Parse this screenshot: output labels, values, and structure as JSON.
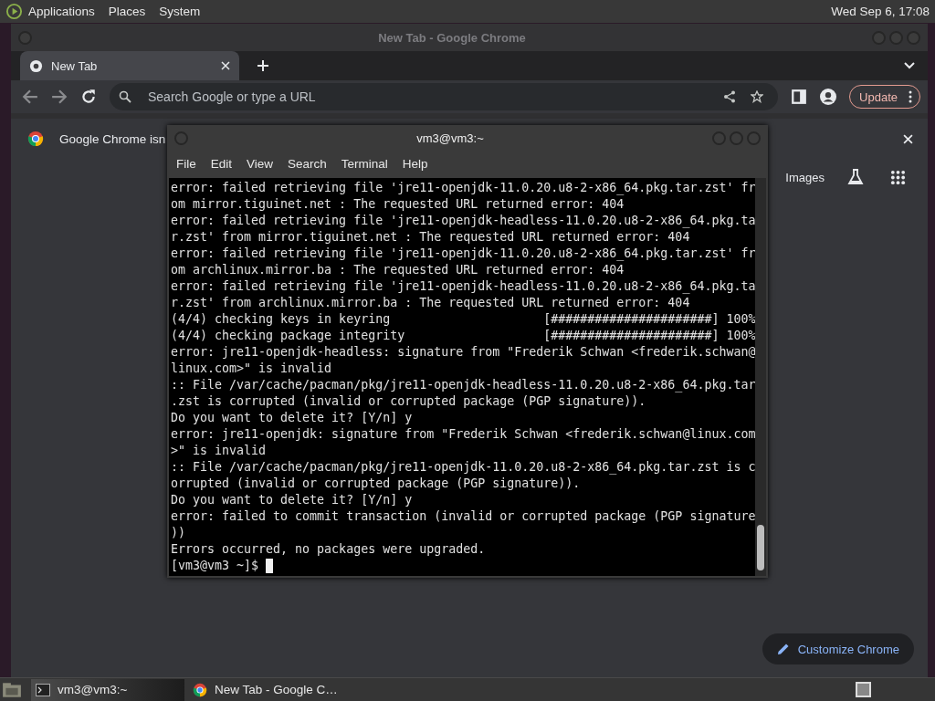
{
  "top_panel": {
    "menus": [
      "Applications",
      "Places",
      "System"
    ],
    "clock": "Wed Sep  6, 17:08"
  },
  "chrome": {
    "title": "New Tab - Google Chrome",
    "tabs": [
      {
        "label": "New Tab",
        "selected": true
      }
    ],
    "omnibox": {
      "placeholder": "Search Google or type a URL"
    },
    "update_button": "Update",
    "infobar": "Google Chrome isn",
    "links": [
      "Images"
    ],
    "customize_button": "Customize Chrome"
  },
  "terminal": {
    "title": "vm3@vm3:~",
    "menus": [
      "File",
      "Edit",
      "View",
      "Search",
      "Terminal",
      "Help"
    ],
    "lines": [
      "error: failed retrieving file 'jre11-openjdk-11.0.20.u8-2-x86_64.pkg.tar.zst' fr",
      "om mirror.tiguinet.net : The requested URL returned error: 404",
      "error: failed retrieving file 'jre11-openjdk-headless-11.0.20.u8-2-x86_64.pkg.ta",
      "r.zst' from mirror.tiguinet.net : The requested URL returned error: 404",
      "error: failed retrieving file 'jre11-openjdk-11.0.20.u8-2-x86_64.pkg.tar.zst' fr",
      "om archlinux.mirror.ba : The requested URL returned error: 404",
      "error: failed retrieving file 'jre11-openjdk-headless-11.0.20.u8-2-x86_64.pkg.ta",
      "r.zst' from archlinux.mirror.ba : The requested URL returned error: 404",
      "(4/4) checking keys in keyring                     [######################] 100%",
      "(4/4) checking package integrity                   [######################] 100%",
      "error: jre11-openjdk-headless: signature from \"Frederik Schwan <frederik.schwan@",
      "linux.com>\" is invalid",
      ":: File /var/cache/pacman/pkg/jre11-openjdk-headless-11.0.20.u8-2-x86_64.pkg.tar",
      ".zst is corrupted (invalid or corrupted package (PGP signature)).",
      "Do you want to delete it? [Y/n] y",
      "error: jre11-openjdk: signature from \"Frederik Schwan <frederik.schwan@linux.com",
      ">\" is invalid",
      ":: File /var/cache/pacman/pkg/jre11-openjdk-11.0.20.u8-2-x86_64.pkg.tar.zst is c",
      "orrupted (invalid or corrupted package (PGP signature)).",
      "Do you want to delete it? [Y/n] y",
      "error: failed to commit transaction (invalid or corrupted package (PGP signature",
      "))",
      "Errors occurred, no packages were upgraded."
    ],
    "prompt": "[vm3@vm3 ~]$"
  },
  "taskbar": {
    "items": [
      {
        "label": "vm3@vm3:~",
        "kind": "terminal",
        "selected": true
      },
      {
        "label": "New Tab - Google C…",
        "kind": "browser",
        "selected": false
      }
    ]
  }
}
